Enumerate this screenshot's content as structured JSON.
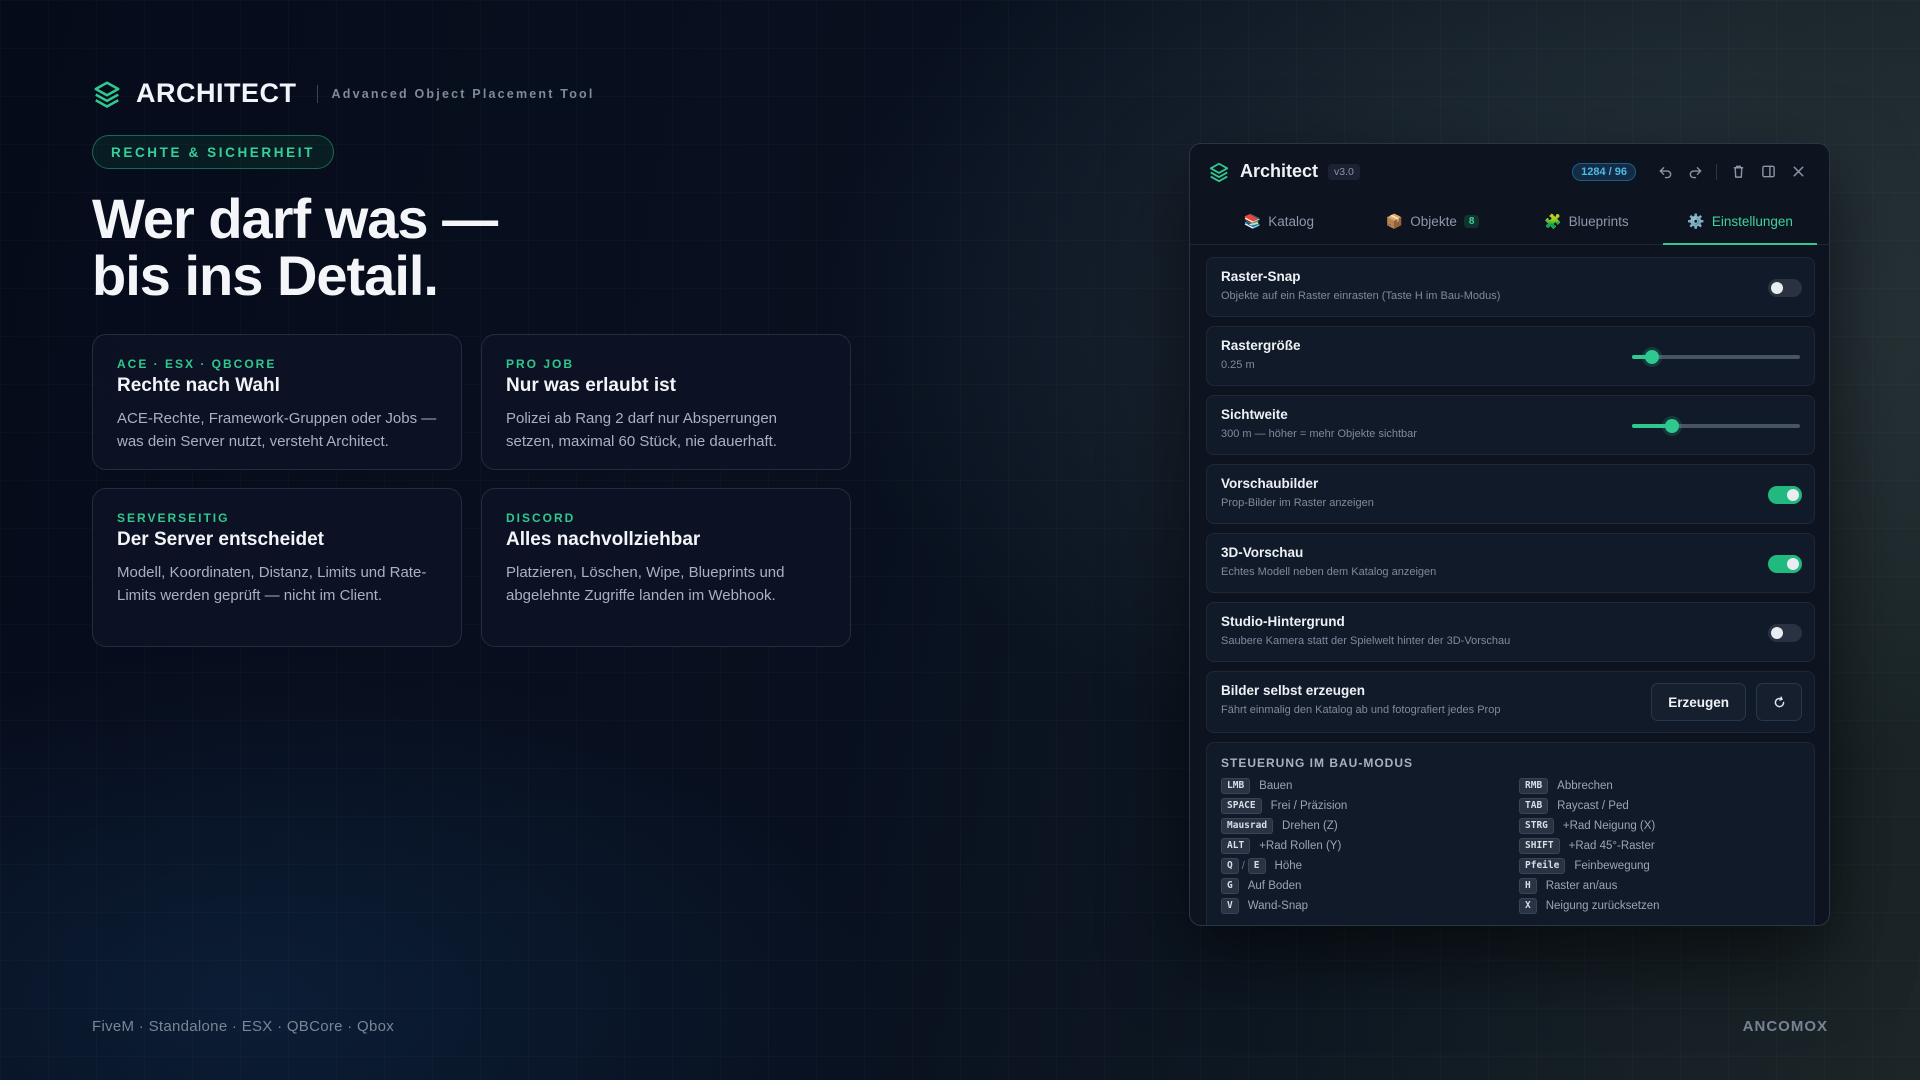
{
  "brand": {
    "name": "ARCHITECT",
    "tagline": "Advanced Object Placement Tool"
  },
  "pill": "RECHTE & SICHERHEIT",
  "headline": {
    "line1": "Wer darf was —",
    "line2": "bis ins Detail."
  },
  "features": [
    {
      "kicker": "ACE · ESX · QBCORE",
      "title": "Rechte nach Wahl",
      "body": "ACE-Rechte, Framework-Gruppen oder Jobs — was dein Server nutzt, versteht Architect."
    },
    {
      "kicker": "PRO JOB",
      "title": "Nur was erlaubt ist",
      "body": "Polizei ab Rang 2 darf nur Absperrungen setzen, maximal 60 Stück, nie dauerhaft."
    },
    {
      "kicker": "SERVERSEITIG",
      "title": "Der Server entscheidet",
      "body": "Modell, Koordinaten, Distanz, Limits und Rate-Limits werden geprüft — nicht im Client."
    },
    {
      "kicker": "DISCORD",
      "title": "Alles nachvollziehbar",
      "body": "Platzieren, Löschen, Wipe, Blueprints und abgelehnte Zugriffe landen im Webhook."
    }
  ],
  "footer": {
    "left": "FiveM · Standalone · ESX · QBCore · Qbox",
    "right": "ANCOMOX"
  },
  "window": {
    "title": "Architect",
    "version": "v3.0",
    "counter": "1284 / 96",
    "icons": [
      "undo-icon",
      "redo-icon",
      "trash-icon",
      "split-view-icon",
      "close-icon"
    ],
    "tabs": [
      {
        "emoji": "📚",
        "label": "Katalog",
        "badge": "",
        "active": false
      },
      {
        "emoji": "📦",
        "label": "Objekte",
        "badge": "8",
        "active": false
      },
      {
        "emoji": "🧩",
        "label": "Blueprints",
        "badge": "",
        "active": false
      },
      {
        "emoji": "⚙️",
        "label": "Einstellungen",
        "badge": "",
        "active": true
      }
    ],
    "settings": [
      {
        "title": "Raster-Snap",
        "desc": "Objekte auf ein Raster einrasten (Taste H im Bau-Modus)",
        "type": "toggle",
        "on": false
      },
      {
        "title": "Rastergröße",
        "desc": "0.25 m",
        "type": "slider",
        "level": 0.12
      },
      {
        "title": "Sichtweite",
        "desc": "300 m — höher = mehr Objekte sichtbar",
        "type": "slider",
        "level": 0.24
      },
      {
        "title": "Vorschaubilder",
        "desc": "Prop-Bilder im Raster anzeigen",
        "type": "toggle",
        "on": true
      },
      {
        "title": "3D-Vorschau",
        "desc": "Echtes Modell neben dem Katalog anzeigen",
        "type": "toggle",
        "on": true
      },
      {
        "title": "Studio-Hintergrund",
        "desc": "Saubere Kamera statt der Spielwelt hinter der 3D-Vorschau",
        "type": "toggle",
        "on": false
      }
    ],
    "generate": {
      "title": "Bilder selbst erzeugen",
      "desc": "Fährt einmalig den Katalog ab und fotografiert jedes Prop",
      "button": "Erzeugen"
    },
    "controls": {
      "title": "STEUERUNG IM BAU-MODUS",
      "left": [
        {
          "keys": [
            "LMB"
          ],
          "label": "Bauen"
        },
        {
          "keys": [
            "SPACE"
          ],
          "label": "Frei / Präzision"
        },
        {
          "keys": [
            "Mausrad"
          ],
          "label": "Drehen (Z)"
        },
        {
          "keys": [
            "ALT"
          ],
          "label": "+Rad Rollen (Y)"
        },
        {
          "keys": [
            "Q",
            "E"
          ],
          "label": "Höhe"
        },
        {
          "keys": [
            "G"
          ],
          "label": "Auf Boden"
        },
        {
          "keys": [
            "V"
          ],
          "label": "Wand-Snap"
        }
      ],
      "right": [
        {
          "keys": [
            "RMB"
          ],
          "label": "Abbrechen"
        },
        {
          "keys": [
            "TAB"
          ],
          "label": "Raycast / Ped"
        },
        {
          "keys": [
            "STRG"
          ],
          "label": "+Rad Neigung (X)"
        },
        {
          "keys": [
            "SHIFT"
          ],
          "label": "+Rad 45°-Raster"
        },
        {
          "keys": [
            "Pfeile"
          ],
          "label": "Feinbewegung"
        },
        {
          "keys": [
            "H"
          ],
          "label": "Raster an/aus"
        },
        {
          "keys": [
            "X"
          ],
          "label": "Neigung zurücksetzen"
        }
      ]
    }
  }
}
